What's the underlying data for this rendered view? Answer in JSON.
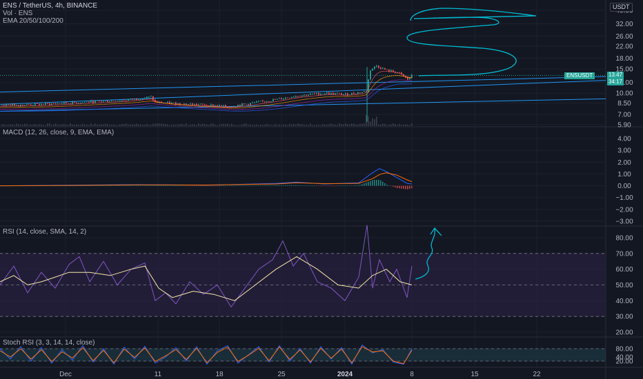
{
  "header": {
    "symbol_line": "ENS / TetherUS, 4h, BINANCE",
    "vol_line": "Vol · ENS",
    "ema_line": "EMA 20/50/100/200",
    "currency": "USDT"
  },
  "price_badge": {
    "symbol": "ENSUSDT",
    "price": "13.47",
    "countdown": "34:17"
  },
  "colors": {
    "background": "#131722",
    "grid": "#1e222d",
    "up": "#26a69a",
    "down": "#ef5350",
    "trendline": "#2196f3",
    "drawing": "#00bcd4",
    "rsi_line": "#7e57c2",
    "rsi_ma": "#f5e8a8",
    "rsi_band": "#2a2140",
    "stoch_band": "#1c3340",
    "macd_line": "#2962ff",
    "macd_signal": "#ff6d00",
    "stoch_k": "#2962ff",
    "stoch_d": "#ff6d00"
  },
  "panels": {
    "macd": {
      "title": "MACD (12, 26, close, 9, EMA, EMA)"
    },
    "rsi": {
      "title": "RSI (14, close, SMA, 14, 2)"
    },
    "stoch": {
      "title": "Stoch RSI (3, 3, 14, 14, close)"
    }
  },
  "x_axis": {
    "labels": [
      "Dec",
      "11",
      "18",
      "25",
      "2024",
      "8",
      "15",
      "22"
    ],
    "bold_label": "2024"
  },
  "chart_data": [
    {
      "type": "candlestick",
      "title": "ENS / TetherUS, 4h, BINANCE",
      "y_scale": "log",
      "y_ticks": [
        "40.00",
        "32.00",
        "26.00",
        "22.00",
        "18.00",
        "15.00",
        "12.00",
        "10.00",
        "8.50",
        "7.00",
        "5.90"
      ],
      "series": [
        {
          "name": "EMA 20/50/100/200"
        }
      ],
      "price_path": [
        [
          0,
          8.2
        ],
        [
          60,
          8.3
        ],
        [
          120,
          8.6
        ],
        [
          180,
          8.9
        ],
        [
          220,
          9.4
        ],
        [
          222,
          8.6
        ],
        [
          260,
          8.4
        ],
        [
          300,
          8.2
        ],
        [
          330,
          8.0
        ],
        [
          360,
          8.4
        ],
        [
          400,
          9.0
        ],
        [
          430,
          9.6
        ],
        [
          470,
          10.0
        ],
        [
          500,
          9.8
        ],
        [
          530,
          10.3
        ],
        [
          536,
          14.8
        ],
        [
          545,
          15.8
        ],
        [
          560,
          14.6
        ],
        [
          575,
          14.2
        ],
        [
          590,
          12.6
        ],
        [
          597,
          13.5
        ]
      ],
      "last_price": 13.47,
      "trendlines": "3 ascending lines",
      "volume": "spike near 2024"
    },
    {
      "type": "line",
      "title": "MACD (12, 26, close, 9, EMA, EMA)",
      "y_ticks": [
        "4.00",
        "3.00",
        "2.00",
        "1.00",
        "0.00",
        "−1.00",
        "−2.00",
        "−3.00"
      ],
      "ylim": [
        -3,
        4
      ],
      "series": [
        {
          "color": "#2962ff",
          "x": [
            0,
            100,
            200,
            300,
            400,
            430,
            470,
            520,
            540,
            550,
            560,
            575,
            590,
            597
          ],
          "values": [
            0.0,
            0.05,
            0.1,
            0.05,
            0.2,
            0.3,
            0.15,
            0.25,
            1.1,
            1.45,
            1.2,
            0.7,
            0.2,
            0.15
          ]
        },
        {
          "color": "#ff6d00",
          "x": [
            0,
            100,
            200,
            300,
            400,
            430,
            470,
            520,
            540,
            550,
            560,
            575,
            590,
            597
          ],
          "values": [
            0.0,
            0.03,
            0.08,
            0.06,
            0.15,
            0.25,
            0.18,
            0.2,
            0.6,
            0.95,
            1.1,
            0.9,
            0.5,
            0.35
          ]
        }
      ]
    },
    {
      "type": "line",
      "title": "RSI (14, close, SMA, 14, 2)",
      "y_ticks": [
        "80.00",
        "70.00",
        "60.00",
        "50.00",
        "40.00",
        "30.00",
        "20.00"
      ],
      "ylim": [
        20,
        80
      ],
      "bands": [
        30,
        50,
        70
      ],
      "series": [
        {
          "color": "#7e57c2",
          "x": [
            0,
            20,
            40,
            60,
            80,
            100,
            115,
            130,
            150,
            170,
            190,
            210,
            225,
            240,
            255,
            275,
            295,
            315,
            335,
            355,
            375,
            395,
            410,
            425,
            440,
            460,
            480,
            500,
            520,
            532,
            540,
            550,
            565,
            575,
            590,
            597
          ],
          "values": [
            50,
            62,
            45,
            58,
            48,
            63,
            68,
            52,
            65,
            50,
            60,
            64,
            40,
            45,
            38,
            52,
            44,
            50,
            36,
            48,
            60,
            66,
            78,
            62,
            70,
            52,
            48,
            40,
            55,
            88,
            48,
            66,
            52,
            60,
            42,
            62
          ]
        },
        {
          "color": "#f5e8a8",
          "x": [
            0,
            20,
            40,
            60,
            80,
            100,
            130,
            160,
            190,
            210,
            230,
            250,
            280,
            310,
            340,
            370,
            400,
            430,
            460,
            490,
            520,
            540,
            560,
            580,
            597
          ],
          "values": [
            52,
            56,
            50,
            52,
            55,
            58,
            58,
            56,
            60,
            62,
            48,
            42,
            46,
            44,
            40,
            50,
            60,
            68,
            60,
            50,
            48,
            56,
            60,
            52,
            50
          ]
        }
      ]
    },
    {
      "type": "line",
      "title": "Stoch RSI (3, 3, 14, 14, close)",
      "y_ticks": [
        "80.00",
        "40.00",
        "20.00"
      ],
      "ylim": [
        0,
        100
      ],
      "bands": [
        20,
        80
      ],
      "series": [
        {
          "color": "#2962ff",
          "x": [
            0,
            15,
            30,
            45,
            60,
            75,
            90,
            105,
            120,
            135,
            150,
            165,
            180,
            195,
            210,
            225,
            240,
            255,
            270,
            285,
            300,
            315,
            330,
            345,
            360,
            375,
            390,
            405,
            420,
            435,
            450,
            465,
            480,
            495,
            510,
            525,
            540,
            555,
            570,
            585,
            597
          ],
          "values": [
            80,
            30,
            90,
            20,
            85,
            10,
            75,
            25,
            95,
            15,
            80,
            5,
            88,
            30,
            92,
            10,
            40,
            85,
            20,
            90,
            5,
            70,
            95,
            10,
            50,
            90,
            15,
            95,
            20,
            80,
            10,
            90,
            30,
            85,
            5,
            98,
            60,
            75,
            15,
            5,
            80
          ]
        },
        {
          "color": "#ff6d00",
          "x": [
            0,
            15,
            30,
            45,
            60,
            75,
            90,
            105,
            120,
            135,
            150,
            165,
            180,
            195,
            210,
            225,
            240,
            255,
            270,
            285,
            300,
            315,
            330,
            345,
            360,
            375,
            390,
            405,
            420,
            435,
            450,
            465,
            480,
            495,
            510,
            525,
            540,
            555,
            570,
            585,
            597
          ],
          "values": [
            70,
            40,
            80,
            30,
            75,
            18,
            65,
            35,
            85,
            22,
            72,
            12,
            78,
            38,
            84,
            18,
            45,
            76,
            28,
            82,
            12,
            62,
            88,
            18,
            48,
            82,
            22,
            88,
            28,
            74,
            16,
            82,
            34,
            78,
            12,
            90,
            64,
            70,
            20,
            8,
            72
          ]
        }
      ]
    }
  ]
}
